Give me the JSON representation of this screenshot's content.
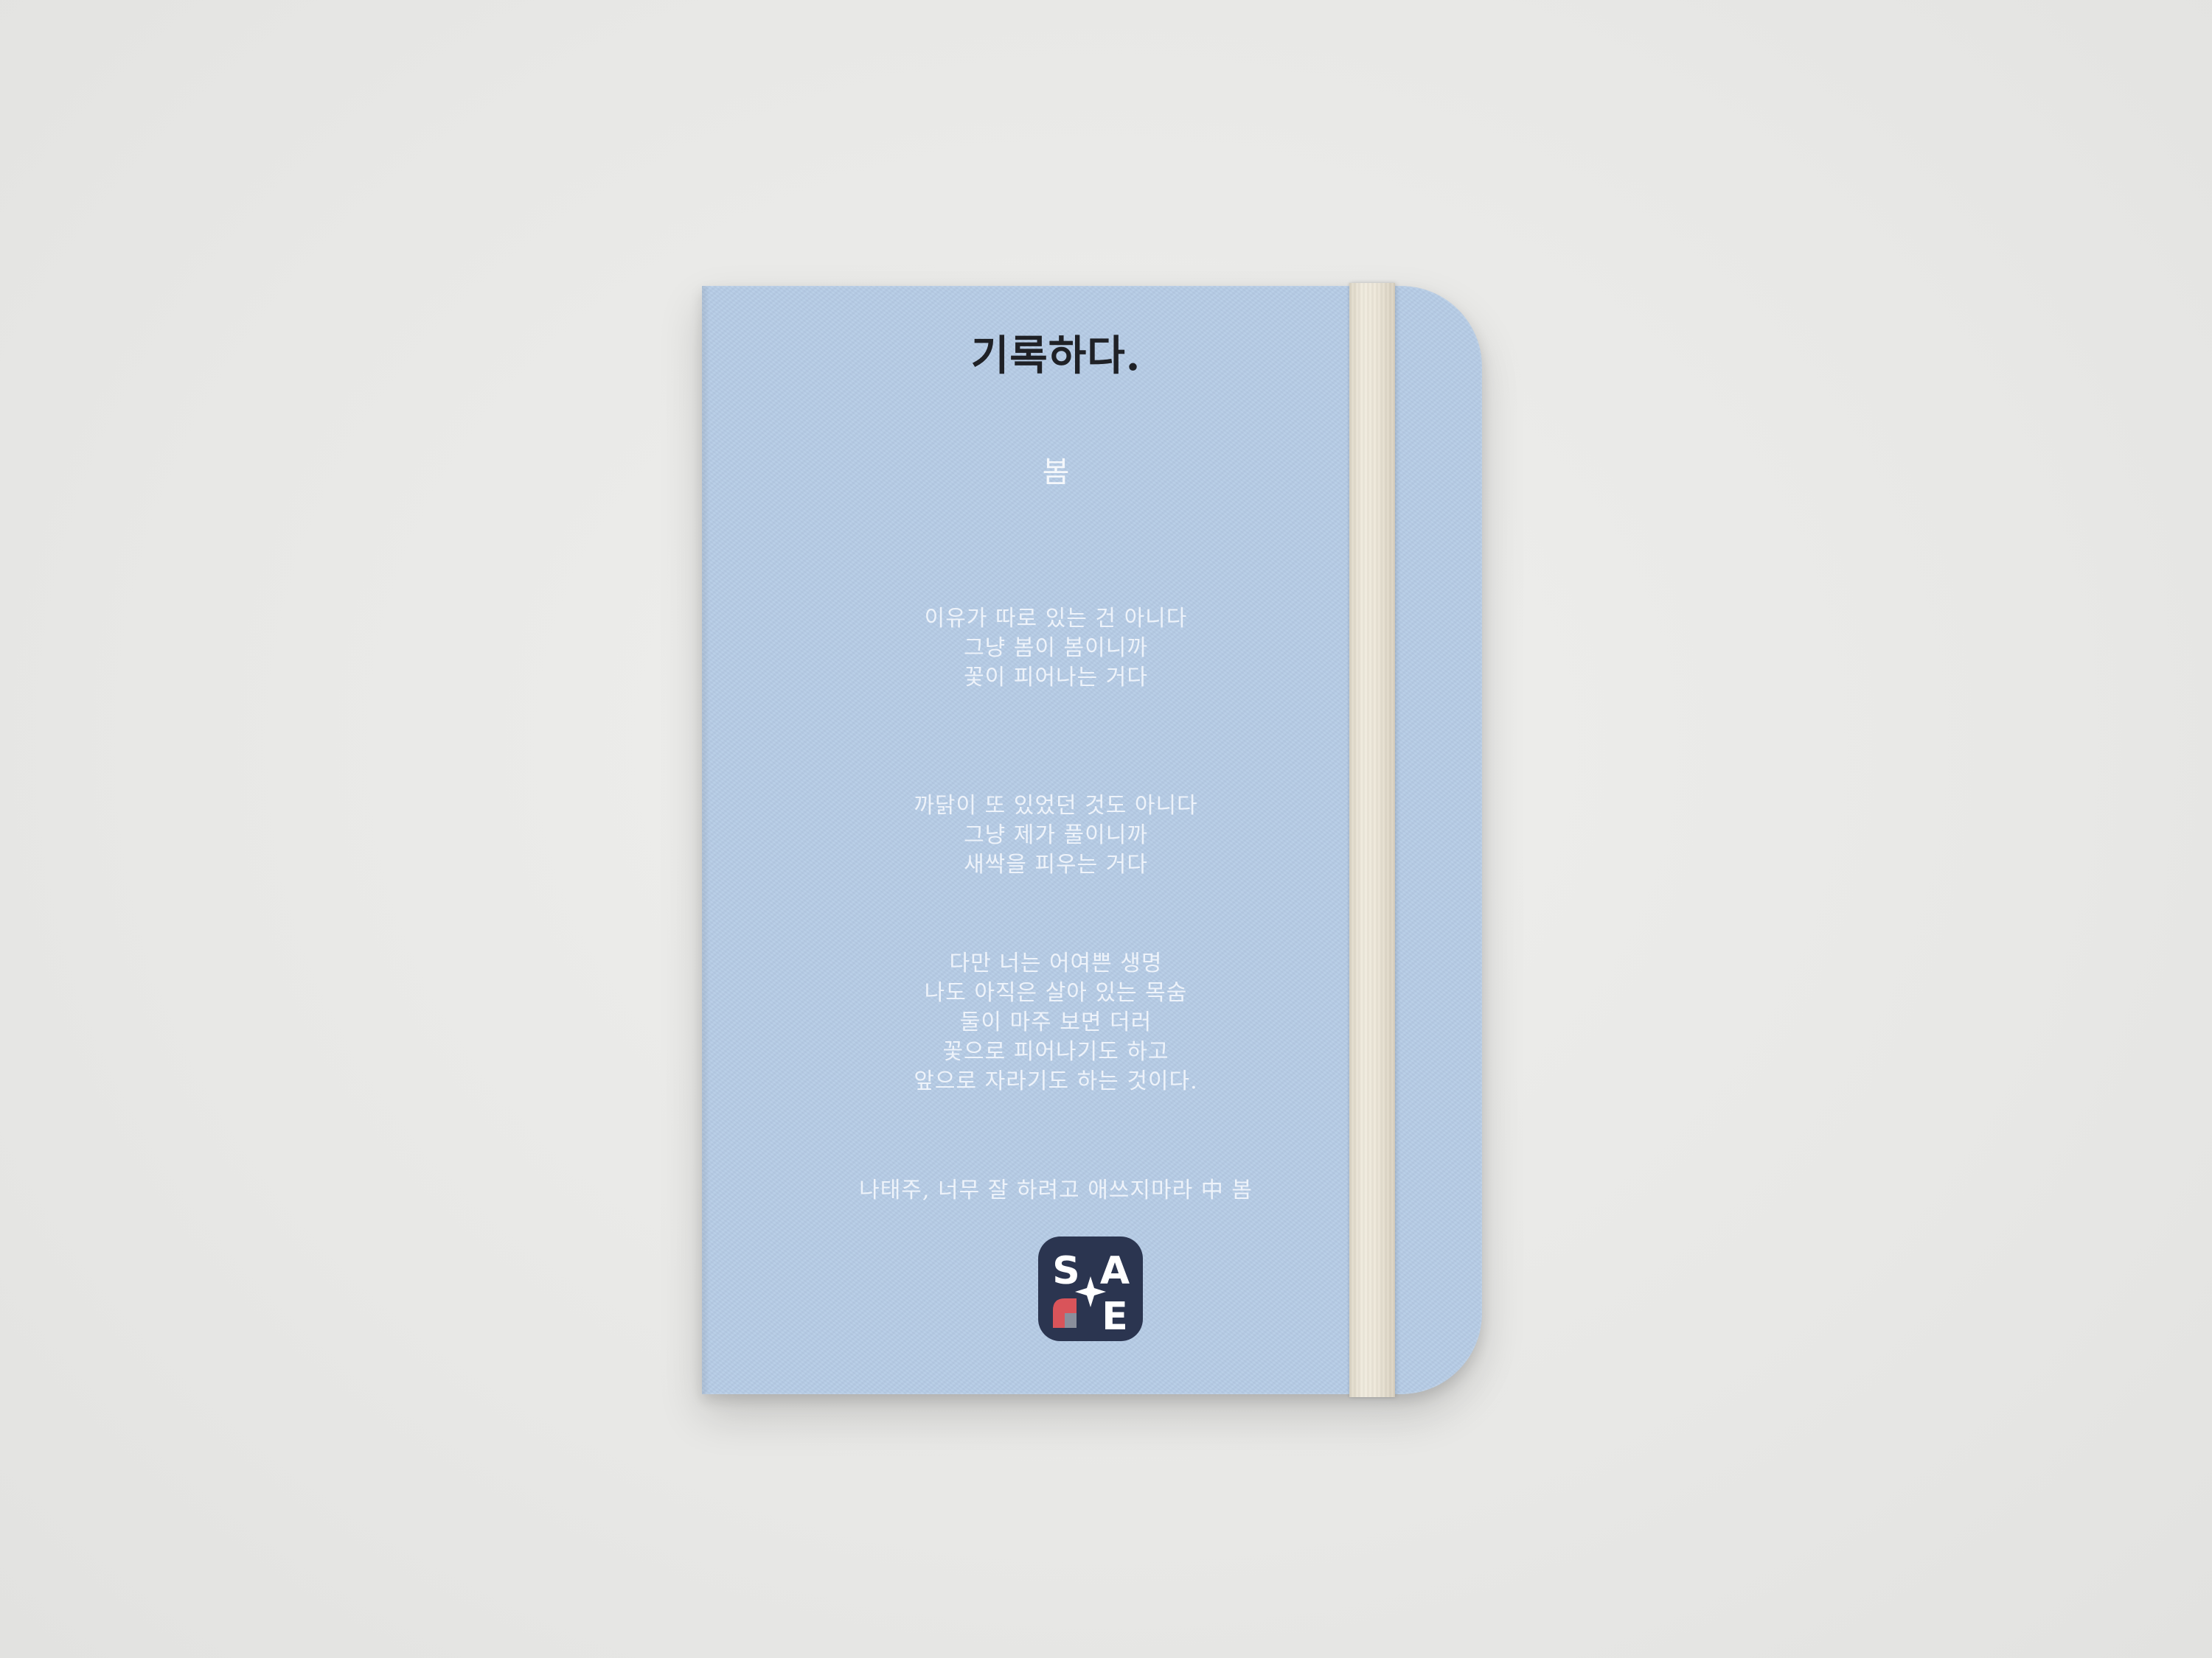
{
  "notebook": {
    "title": "기록하다.",
    "poem_title": "봄",
    "stanzas": [
      [
        "이유가 따로 있는 건 아니다",
        "그냥 봄이 봄이니까",
        "꽃이 피어나는 거다"
      ],
      [
        "까닭이 또 있었던 것도 아니다",
        "그냥 제가 풀이니까",
        "새싹을 피우는 거다"
      ],
      [
        "다만 너는 어여쁜 생명",
        "나도 아직은 살아 있는 목숨",
        "둘이 마주 보면 더러",
        "꽃으로 피어나기도 하고",
        "앞으로 자라기도 하는 것이다."
      ]
    ],
    "credit": "나태주, 너무 잘 하려고 애쓰지마라 中 봄",
    "logo_letters": [
      "S",
      "A",
      "E"
    ],
    "colors": {
      "cover": "#b6cce6",
      "band": "#ece6d8",
      "logo_bg": "#2b3550",
      "logo_accent": "#d9545a"
    }
  }
}
